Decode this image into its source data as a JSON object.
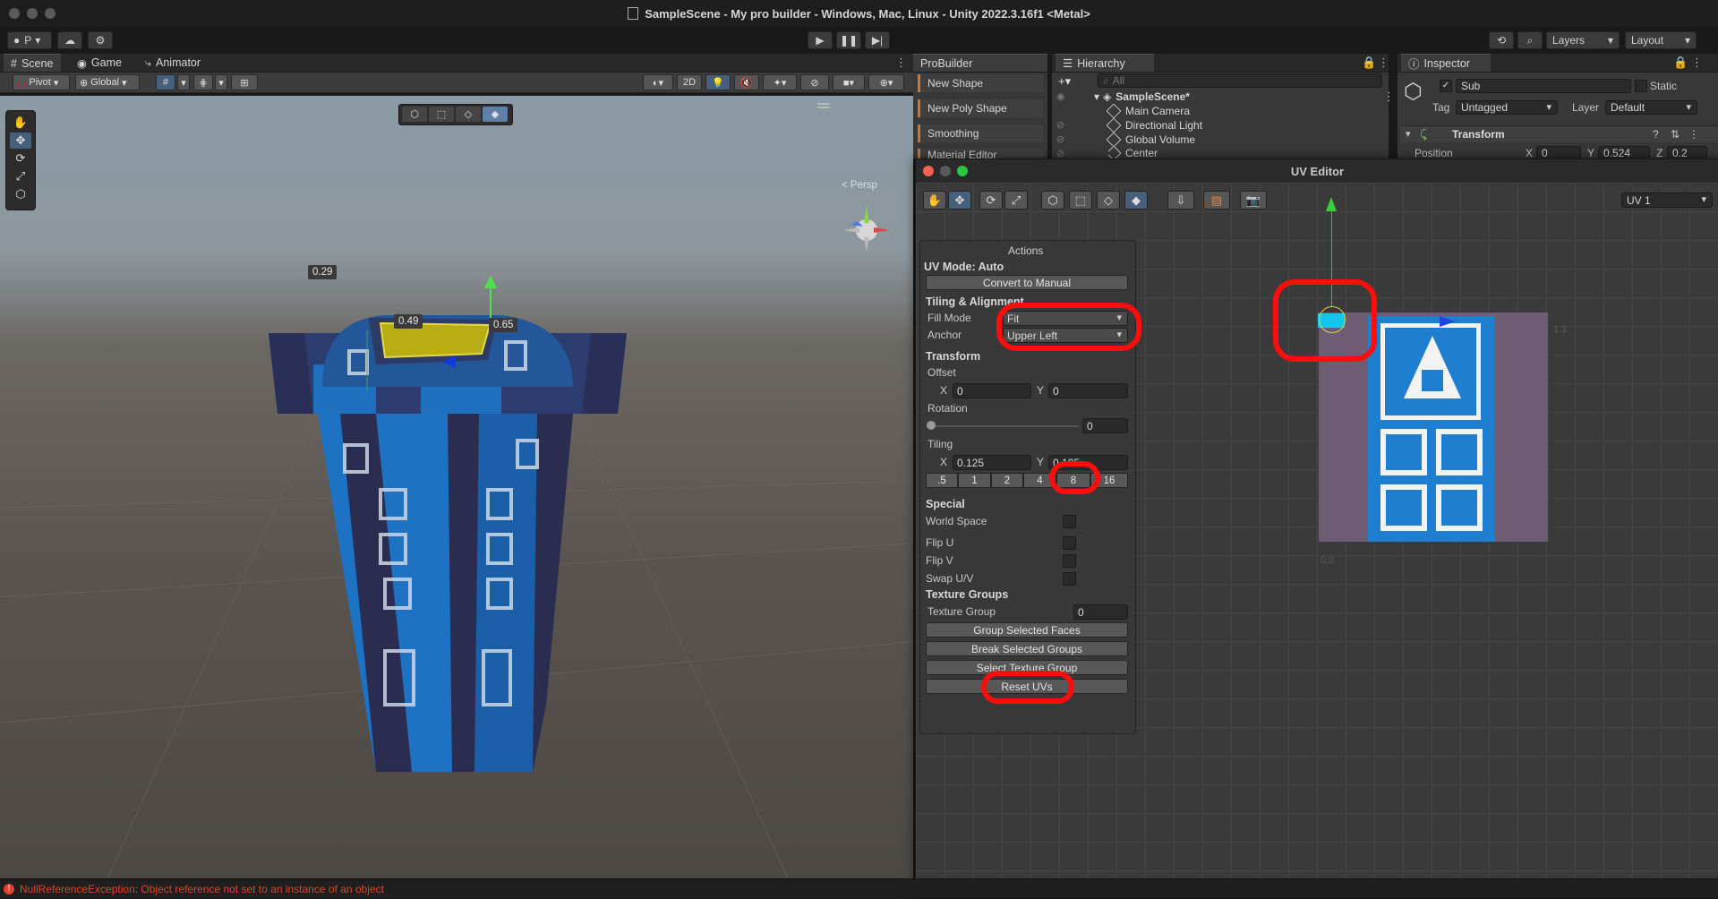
{
  "window": {
    "title": "SampleScene - My pro builder - Windows, Mac, Linux - Unity 2022.3.16f1 <Metal>"
  },
  "toolbar": {
    "account_initial": "P",
    "layers_label": "Layers",
    "layout_label": "Layout"
  },
  "scene_tabs": [
    "Scene",
    "Game",
    "Animator"
  ],
  "scene_toolbar": {
    "pivot": "Pivot",
    "global": "Global",
    "mode_2d": "2D"
  },
  "viewport": {
    "persp_label": "< Persp",
    "dimensions": [
      "0.29",
      "0.49",
      "0.65"
    ]
  },
  "probuilder": {
    "tab": "ProBuilder",
    "items": [
      "New Shape",
      "New Poly Shape",
      "Smoothing",
      "Material Editor"
    ]
  },
  "hierarchy": {
    "tab": "Hierarchy",
    "search_placeholder": "All",
    "scene": "SampleScene*",
    "objects": [
      "Main Camera",
      "Directional Light",
      "Global Volume",
      "Center"
    ]
  },
  "inspector": {
    "tab": "Inspector",
    "object_name": "Sub",
    "static_label": "Static",
    "tag_label": "Tag",
    "tag_value": "Untagged",
    "layer_label": "Layer",
    "layer_value": "Default",
    "component": "Transform",
    "position_label": "Position",
    "pos_x_label": "X",
    "pos_x": "0",
    "pos_y_label": "Y",
    "pos_y": "0.524",
    "pos_z_label": "Z",
    "pos_z": "0.2"
  },
  "uv_editor": {
    "title": "UV Editor",
    "channel": "UV 1",
    "actions": {
      "header": "Actions",
      "uv_mode": "UV Mode: Auto",
      "convert_button": "Convert to Manual",
      "tiling_alignment": "Tiling & Alignment",
      "fill_mode_label": "Fill Mode",
      "fill_mode_value": "Fit",
      "anchor_label": "Anchor",
      "anchor_value": "Upper Left",
      "transform_header": "Transform",
      "offset_label": "Offset",
      "offset_x_label": "X",
      "offset_x": "0",
      "offset_y_label": "Y",
      "offset_y": "0",
      "rotation_label": "Rotation",
      "rotation_value": "0",
      "tiling_label": "Tiling",
      "tiling_x_label": "X",
      "tiling_x": "0.125",
      "tiling_y_label": "Y",
      "tiling_y": "0.125",
      "tiling_presets": [
        ".5",
        "1",
        "2",
        "4",
        "8",
        "16"
      ],
      "special_header": "Special",
      "world_space": "World Space",
      "flip_u": "Flip U",
      "flip_v": "Flip V",
      "swap_uv": "Swap U/V",
      "texture_groups_header": "Texture Groups",
      "texture_group_label": "Texture Group",
      "texture_group_value": "0",
      "group_selected_faces": "Group Selected Faces",
      "break_selected_groups": "Break Selected Groups",
      "select_texture_group": "Select Texture Group",
      "reset_uvs": "Reset UVs"
    },
    "grid_labels": [
      "0,0",
      "1,1"
    ]
  },
  "status": {
    "error_message": "NullReferenceException: Object reference not set to an instance of an object"
  },
  "colors": {
    "annotation_red": "#ff0d0d",
    "texture_blue": "#1e7fd0",
    "probuilder_orange": "#c8753a"
  }
}
